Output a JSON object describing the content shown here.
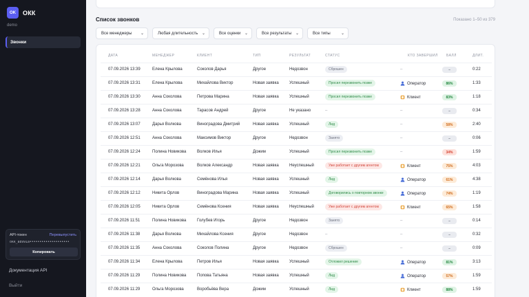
{
  "app": {
    "logo_letters": "OK",
    "name": "ОКК",
    "workspace": "demo"
  },
  "sidebar": {
    "nav": [
      {
        "label": "Звонки"
      }
    ],
    "token": {
      "title": "API-токен",
      "reissue_label": "Перевыпустить",
      "value": "okk_a8991a••••••••••••••••••••",
      "copy_label": "Копировать"
    },
    "api_docs_label": "Документация API",
    "logout_label": "Выйти"
  },
  "main": {
    "title": "Список звонков",
    "shown": "Показано 1–50 из 379",
    "filters": [
      {
        "value": "Все менеджеры"
      },
      {
        "value": "Любая длительность"
      },
      {
        "value": "Все оценки"
      },
      {
        "value": "Все результаты"
      },
      {
        "value": "Все типы"
      }
    ],
    "columns": [
      "Дата",
      "Менеджер",
      "Клиент",
      "Тип",
      "Результат",
      "Статус",
      "Кто завершил",
      "Балл",
      "Длит."
    ],
    "rows": [
      {
        "date": "07.09.2026 13:39",
        "manager": "Елена Крылова",
        "client": "Соколов Дарья",
        "type": "Другое",
        "result": "Недозвон",
        "status": "Сброшен",
        "status_tone": "grey",
        "ended_by": "–",
        "ended_icon": "",
        "score": "–",
        "score_tone": "grey",
        "duration": "0:22"
      },
      {
        "date": "07.09.2026 13:31",
        "manager": "Елена Крылова",
        "client": "Михайлова Виктор",
        "type": "Новая заявка",
        "result": "Успешный",
        "status": "Просил перезвонить позже",
        "status_tone": "green",
        "ended_by": "Оператор",
        "ended_icon": "operator",
        "score": "86%",
        "score_tone": "green",
        "duration": "1:33"
      },
      {
        "date": "07.09.2026 13:30",
        "manager": "Анна Соколова",
        "client": "Петрова Марина",
        "type": "Новая заявка",
        "result": "Успешный",
        "status": "Просил перезвонить позже",
        "status_tone": "green",
        "ended_by": "Клиент",
        "ended_icon": "client",
        "score": "83%",
        "score_tone": "green",
        "duration": "1:18"
      },
      {
        "date": "07.09.2026 13:28",
        "manager": "Анна Соколова",
        "client": "Тарасов Андрей",
        "type": "Другое",
        "result": "Не указано",
        "status": "–",
        "status_tone": "none",
        "ended_by": "–",
        "ended_icon": "",
        "score": "–",
        "score_tone": "grey",
        "duration": "0:34"
      },
      {
        "date": "07.09.2026 13:07",
        "manager": "Дарья Волкова",
        "client": "Виноградова Дмитрий",
        "type": "Новая заявка",
        "result": "Успешный",
        "status": "Лид",
        "status_tone": "green",
        "ended_by": "–",
        "ended_icon": "",
        "score": "58%",
        "score_tone": "orange",
        "duration": "2:40"
      },
      {
        "date": "07.09.2026 12:51",
        "manager": "Анна Соколова",
        "client": "Максимов Виктор",
        "type": "Другое",
        "result": "Недозвон",
        "status": "Занято",
        "status_tone": "grey",
        "ended_by": "–",
        "ended_icon": "",
        "score": "–",
        "score_tone": "grey",
        "duration": "0:06"
      },
      {
        "date": "07.09.2026 12:24",
        "manager": "Полина Новикова",
        "client": "Волков Илья",
        "type": "Дожим",
        "result": "Успешный",
        "status": "Просил перезвонить позже",
        "status_tone": "green",
        "ended_by": "–",
        "ended_icon": "",
        "score": "34%",
        "score_tone": "red",
        "duration": "1:59"
      },
      {
        "date": "07.09.2026 12:21",
        "manager": "Ольга Морозова",
        "client": "Волков Александр",
        "type": "Новая заявка",
        "result": "Неуспешный",
        "status": "Уже работает с другим агентом",
        "status_tone": "red",
        "ended_by": "Клиент",
        "ended_icon": "client",
        "score": "75%",
        "score_tone": "orange",
        "duration": "4:03"
      },
      {
        "date": "07.09.2026 12:14",
        "manager": "Дарья Волкова",
        "client": "Семёнова Илья",
        "type": "Новая заявка",
        "result": "Успешный",
        "status": "Лид",
        "status_tone": "green",
        "ended_by": "Оператор",
        "ended_icon": "operator",
        "score": "61%",
        "score_tone": "orange",
        "duration": "4:38"
      },
      {
        "date": "07.09.2026 12:12",
        "manager": "Никита Орлов",
        "client": "Виноградова Марина",
        "type": "Новая заявка",
        "result": "Успешный",
        "status": "Договорились о повторном звонке",
        "status_tone": "green",
        "ended_by": "Оператор",
        "ended_icon": "operator",
        "score": "74%",
        "score_tone": "orange",
        "duration": "1:19"
      },
      {
        "date": "07.09.2026 12:05",
        "manager": "Никита Орлов",
        "client": "Семёнова Ксения",
        "type": "Новая заявка",
        "result": "Неуспешный",
        "status": "Уже работает с другим агентом",
        "status_tone": "red",
        "ended_by": "Клиент",
        "ended_icon": "client",
        "score": "65%",
        "score_tone": "orange",
        "duration": "1:58"
      },
      {
        "date": "07.09.2026 11:51",
        "manager": "Полина Новикова",
        "client": "Голубев Игорь",
        "type": "Другое",
        "result": "Недозвон",
        "status": "Занято",
        "status_tone": "grey",
        "ended_by": "–",
        "ended_icon": "",
        "score": "–",
        "score_tone": "grey",
        "duration": "0:14"
      },
      {
        "date": "07.09.2026 11:38",
        "manager": "Дарья Волкова",
        "client": "Михайлова Ксения",
        "type": "Другое",
        "result": "Недозвон",
        "status": "–",
        "status_tone": "none",
        "ended_by": "–",
        "ended_icon": "",
        "score": "–",
        "score_tone": "grey",
        "duration": "0:32"
      },
      {
        "date": "07.09.2026 11:35",
        "manager": "Анна Соколова",
        "client": "Соколов Полина",
        "type": "Другое",
        "result": "Недозвон",
        "status": "Сброшен",
        "status_tone": "grey",
        "ended_by": "–",
        "ended_icon": "",
        "score": "–",
        "score_tone": "grey",
        "duration": "0:09"
      },
      {
        "date": "07.09.2026 11:34",
        "manager": "Елена Крылова",
        "client": "Петров Илья",
        "type": "Новая заявка",
        "result": "Успешный",
        "status": "Отложил решение",
        "status_tone": "green",
        "ended_by": "Оператор",
        "ended_icon": "operator",
        "score": "81%",
        "score_tone": "green",
        "duration": "3:13"
      },
      {
        "date": "07.09.2026 11:29",
        "manager": "Полина Новикова",
        "client": "Попова Татьяна",
        "type": "Новая заявка",
        "result": "Успешный",
        "status": "Лид",
        "status_tone": "green",
        "ended_by": "Оператор",
        "ended_icon": "operator",
        "score": "57%",
        "score_tone": "orange",
        "duration": "1:59"
      },
      {
        "date": "07.09.2026 11:29",
        "manager": "Ольга Морозова",
        "client": "Воробьёва Вера",
        "type": "Дожим",
        "result": "Успешный",
        "status": "Лид",
        "status_tone": "green",
        "ended_by": "Клиент",
        "ended_icon": "client",
        "score": "88%",
        "score_tone": "green",
        "duration": "1:59"
      }
    ]
  }
}
